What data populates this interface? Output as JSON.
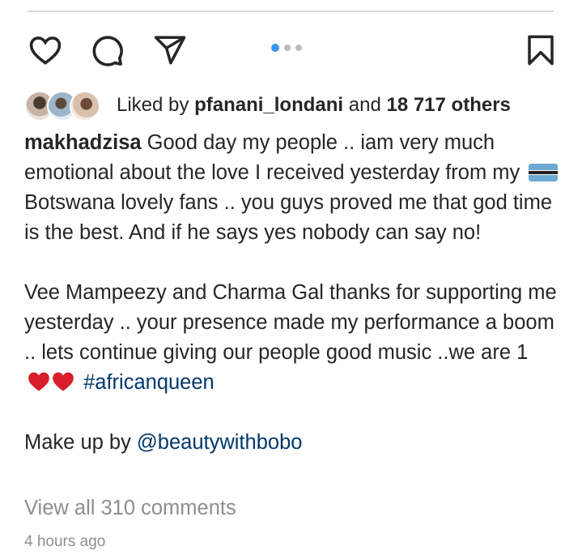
{
  "actions": {
    "like_icon": "heart-icon",
    "comment_icon": "comment-icon",
    "share_icon": "share-icon",
    "save_icon": "bookmark-icon"
  },
  "carousel": {
    "count": 3,
    "active_index": 0,
    "accent": "#3897f0"
  },
  "likes": {
    "prefix": "Liked by ",
    "username": "pfanani_londani",
    "middle": " and ",
    "count_text": "18 717 others"
  },
  "post": {
    "author": "makhadzisa",
    "para1_a": " Good day my people .. iam very much emotional about the love I received yesterday from my ",
    "para1_b": " Botswana lovely fans .. you guys proved me that god time is the best. And if he says yes nobody can say no!",
    "para2_a": "Vee Mampeezy and Charma Gal thanks for supporting me yesterday .. your presence made my performance  a boom .. lets continue giving our people good music ..we are 1 ",
    "hashtag": "#africanqueen",
    "para3_prefix": "Make up by ",
    "mention": "@beautywithbobo",
    "link_color": "#00376b"
  },
  "comments_link": "View all 310 comments",
  "timestamp": "4 hours ago"
}
